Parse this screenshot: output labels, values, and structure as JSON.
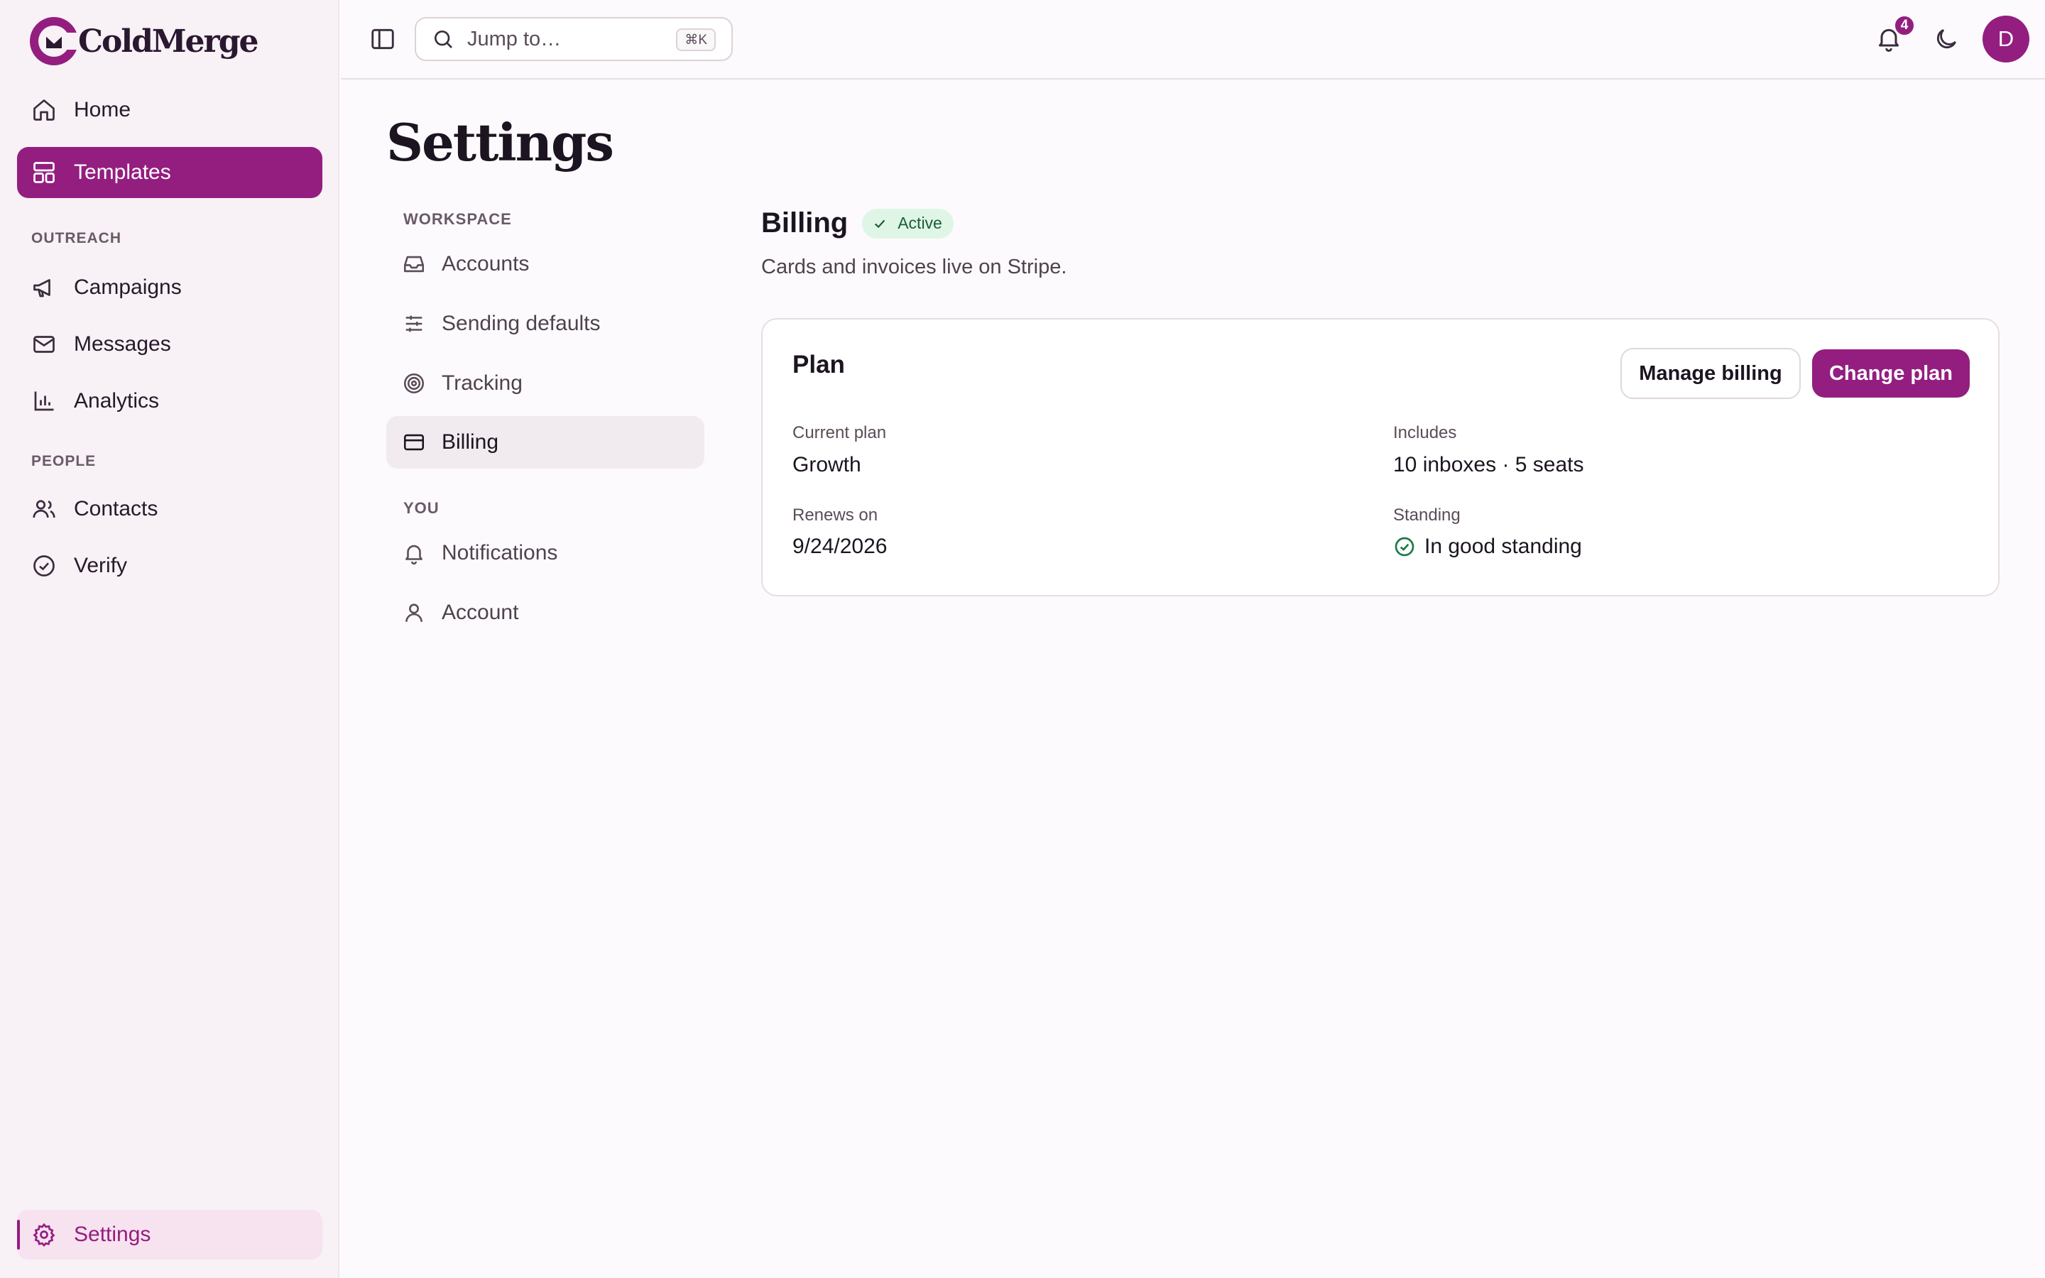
{
  "app": {
    "name": "ColdMerge"
  },
  "sidebar": {
    "items_top": [
      {
        "label": "Home",
        "icon": "home-icon"
      },
      {
        "label": "Templates",
        "icon": "layout-icon",
        "active": true
      }
    ],
    "section_outreach": "OUTREACH",
    "outreach_items": [
      {
        "label": "Campaigns",
        "icon": "megaphone-icon"
      },
      {
        "label": "Messages",
        "icon": "mail-icon"
      },
      {
        "label": "Analytics",
        "icon": "bar-chart-icon"
      }
    ],
    "section_people": "PEOPLE",
    "people_items": [
      {
        "label": "Contacts",
        "icon": "users-icon"
      },
      {
        "label": "Verify",
        "icon": "check-circle-icon"
      }
    ],
    "settings_label": "Settings"
  },
  "topbar": {
    "search_placeholder": "Jump to…",
    "search_shortcut": "⌘K",
    "notification_count": "4",
    "avatar_initial": "D"
  },
  "page": {
    "title": "Settings"
  },
  "settings_nav": {
    "section_workspace": "WORKSPACE",
    "workspace_items": [
      {
        "label": "Accounts",
        "icon": "inbox-icon"
      },
      {
        "label": "Sending defaults",
        "icon": "sliders-icon"
      },
      {
        "label": "Tracking",
        "icon": "target-icon"
      },
      {
        "label": "Billing",
        "icon": "credit-card-icon",
        "active": true
      }
    ],
    "section_you": "YOU",
    "you_items": [
      {
        "label": "Notifications",
        "icon": "bell-icon"
      },
      {
        "label": "Account",
        "icon": "user-icon"
      }
    ]
  },
  "billing": {
    "title": "Billing",
    "status": "Active",
    "description": "Cards and invoices live on Stripe.",
    "card": {
      "title": "Plan",
      "manage_label": "Manage billing",
      "change_label": "Change plan",
      "current_plan_label": "Current plan",
      "current_plan_value": "Growth",
      "includes_label": "Includes",
      "includes_value": "10 inboxes · 5 seats",
      "renews_label": "Renews on",
      "renews_value": "9/24/2026",
      "standing_label": "Standing",
      "standing_value": "In good standing"
    }
  },
  "colors": {
    "accent": "#931e80",
    "success": "#1b7a44",
    "success_bg": "#dff6e6"
  }
}
